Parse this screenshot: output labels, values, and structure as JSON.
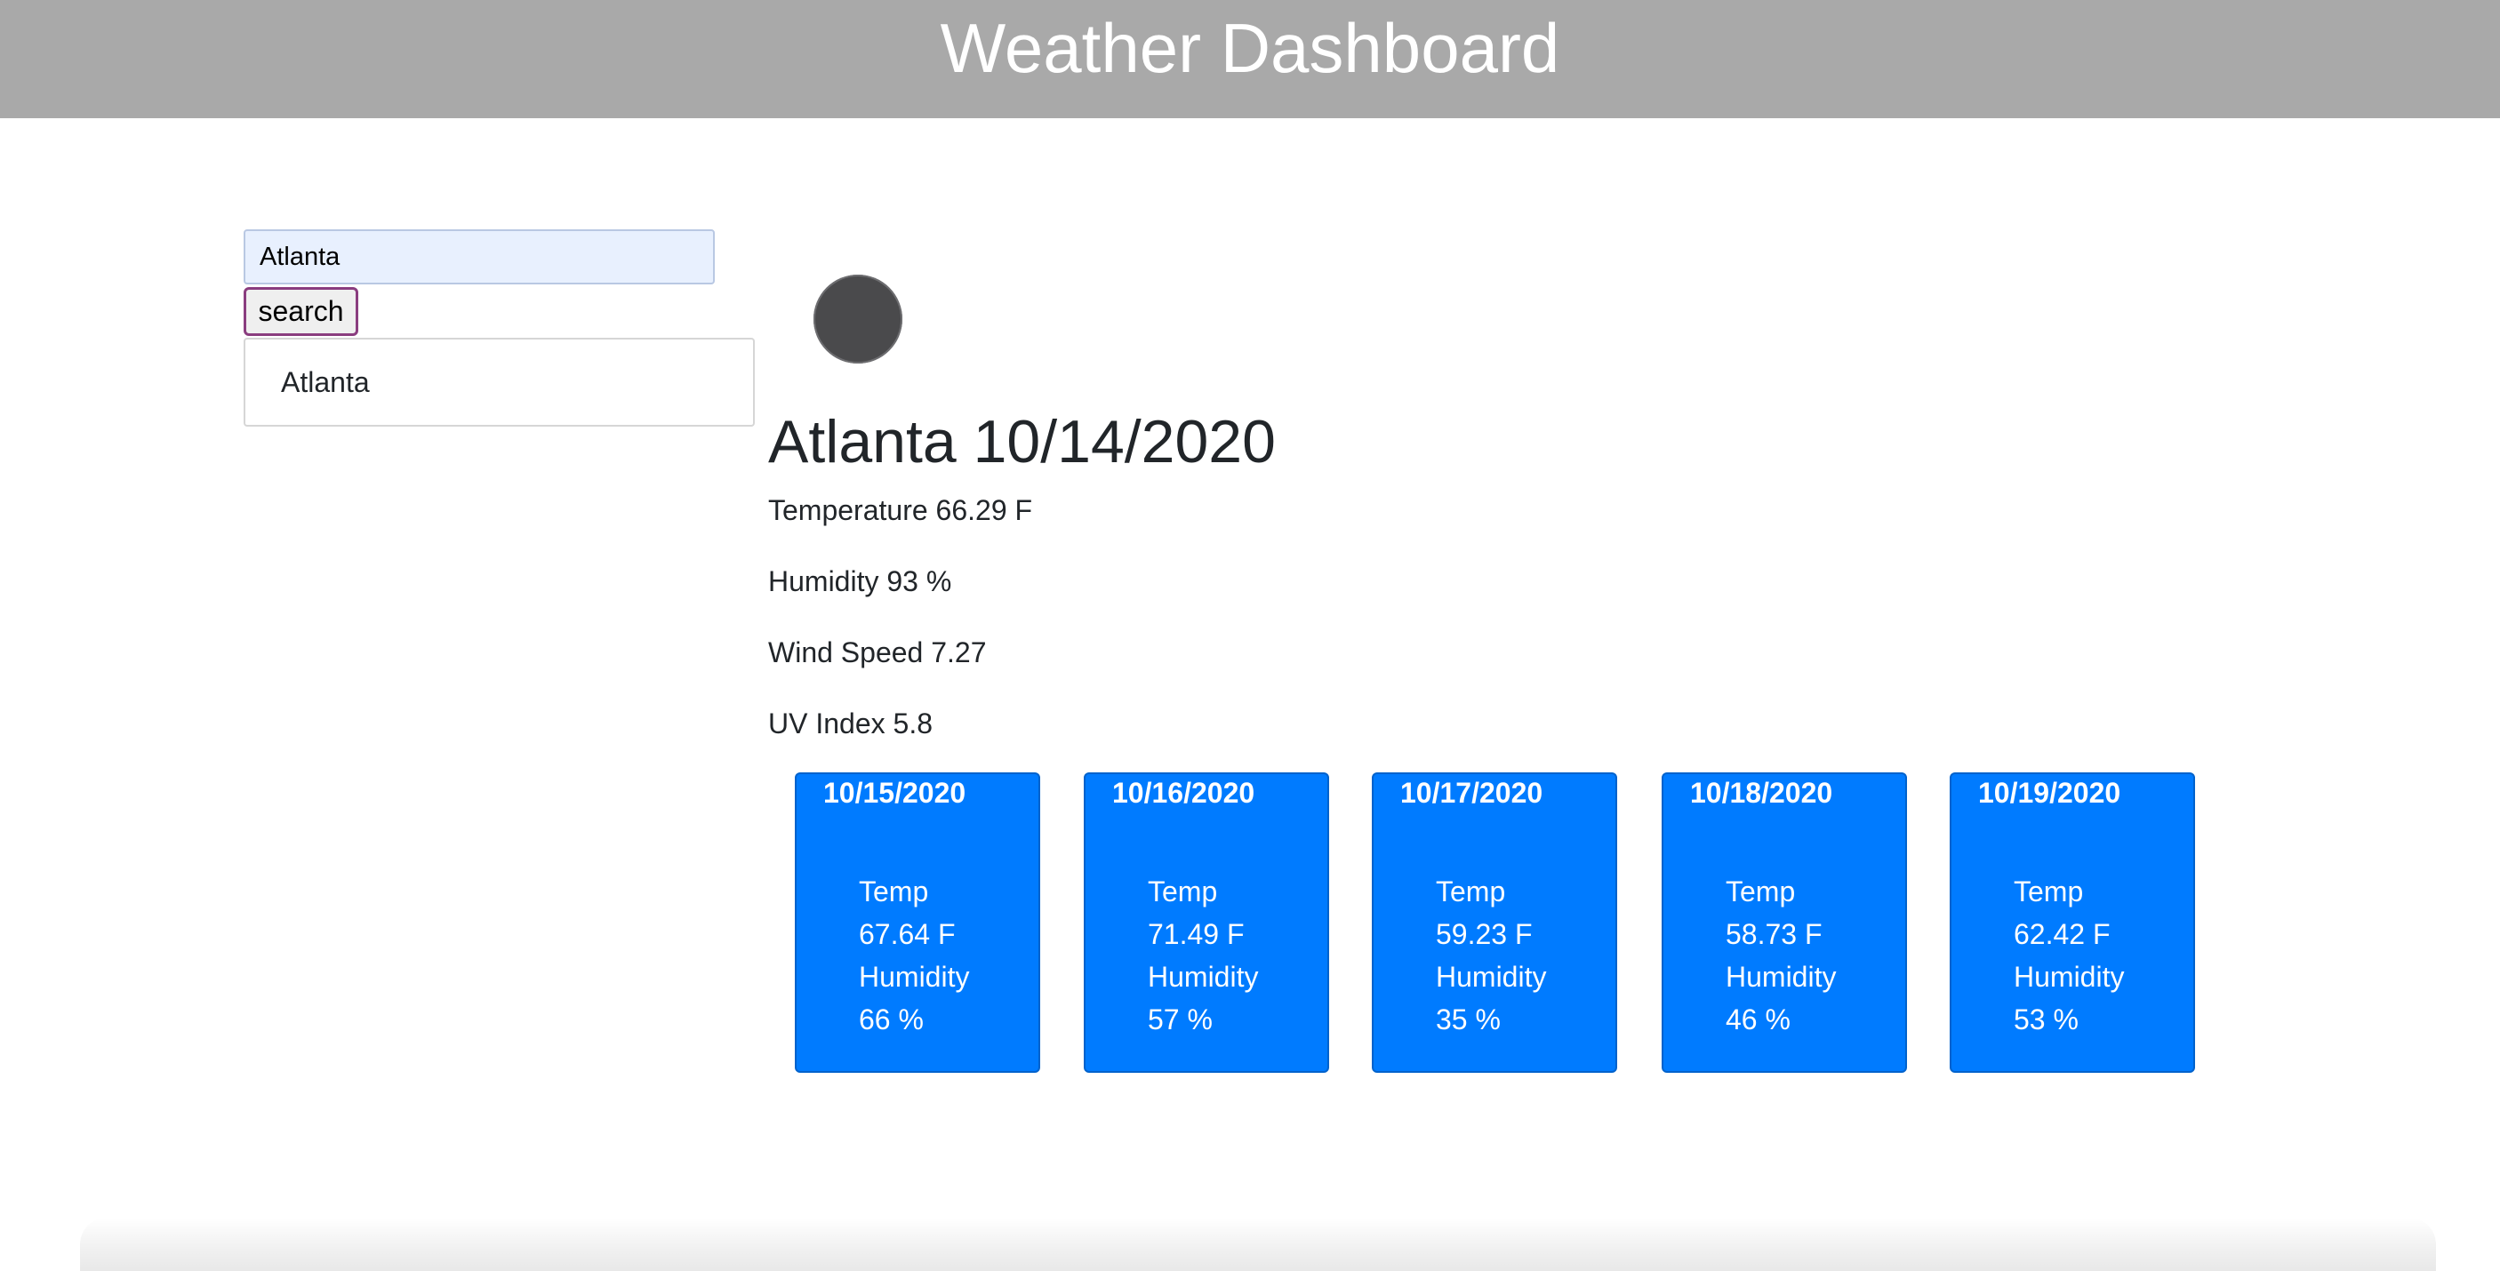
{
  "header": {
    "title": "Weather Dashboard"
  },
  "search": {
    "value": "Atlanta",
    "button_label": "search"
  },
  "history": {
    "items": [
      "Atlanta"
    ]
  },
  "current": {
    "icon": "weather-icon",
    "city_date": "Atlanta 10/14/2020",
    "temperature": "Temperature 66.29 F",
    "humidity": "Humidity 93 %",
    "wind": "Wind Speed 7.27",
    "uv": "UV Index 5.8"
  },
  "forecast": [
    {
      "date": "10/15/2020",
      "temp_label": "Temp",
      "temp": "67.64 F",
      "humidity_label": "Humidity",
      "humidity": "66 %"
    },
    {
      "date": "10/16/2020",
      "temp_label": "Temp",
      "temp": "71.49 F",
      "humidity_label": "Humidity",
      "humidity": "57 %"
    },
    {
      "date": "10/17/2020",
      "temp_label": "Temp",
      "temp": "59.23 F",
      "humidity_label": "Humidity",
      "humidity": "35 %"
    },
    {
      "date": "10/18/2020",
      "temp_label": "Temp",
      "temp": "58.73 F",
      "humidity_label": "Humidity",
      "humidity": "46 %"
    },
    {
      "date": "10/19/2020",
      "temp_label": "Temp",
      "temp": "62.42 F",
      "humidity_label": "Humidity",
      "humidity": "53 %"
    }
  ],
  "colors": {
    "header_bg": "#a9a9a9",
    "card_bg": "#007bff",
    "input_bg": "#e8f0fe",
    "button_border": "#8a3d7f"
  }
}
